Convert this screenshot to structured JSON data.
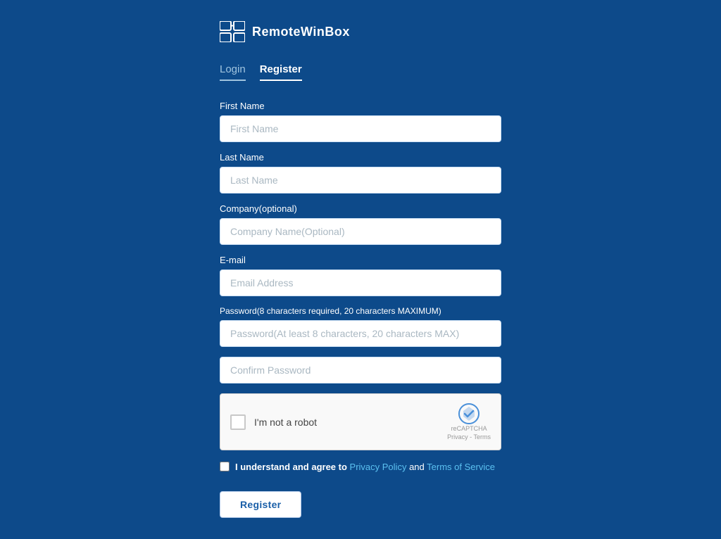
{
  "logo": {
    "text": "RemoteWinBox"
  },
  "tabs": [
    {
      "label": "Login",
      "active": false
    },
    {
      "label": "Register",
      "active": true
    }
  ],
  "form": {
    "fields": [
      {
        "id": "first-name",
        "label": "First Name",
        "placeholder": "First Name",
        "type": "text"
      },
      {
        "id": "last-name",
        "label": "Last Name",
        "placeholder": "Last Name",
        "type": "text"
      },
      {
        "id": "company",
        "label": "Company(optional)",
        "placeholder": "Company Name(Optional)",
        "type": "text"
      },
      {
        "id": "email",
        "label": "E-mail",
        "placeholder": "Email Address",
        "type": "email"
      }
    ],
    "password_label": "Password(8 characters required, 20 characters MAXIMUM)",
    "password_placeholder": "Password(At least 8 characters, 20 characters MAX)",
    "confirm_password_placeholder": "Confirm Password",
    "recaptcha_label": "I'm not a robot",
    "recaptcha_subtext": "reCAPTCHA",
    "recaptcha_links": "Privacy - Terms",
    "agree_text_before": "I understand and agree to ",
    "agree_link1": "Privacy Policy",
    "agree_text_middle": " and ",
    "agree_link2": "Terms of Service",
    "register_button": "Register"
  }
}
